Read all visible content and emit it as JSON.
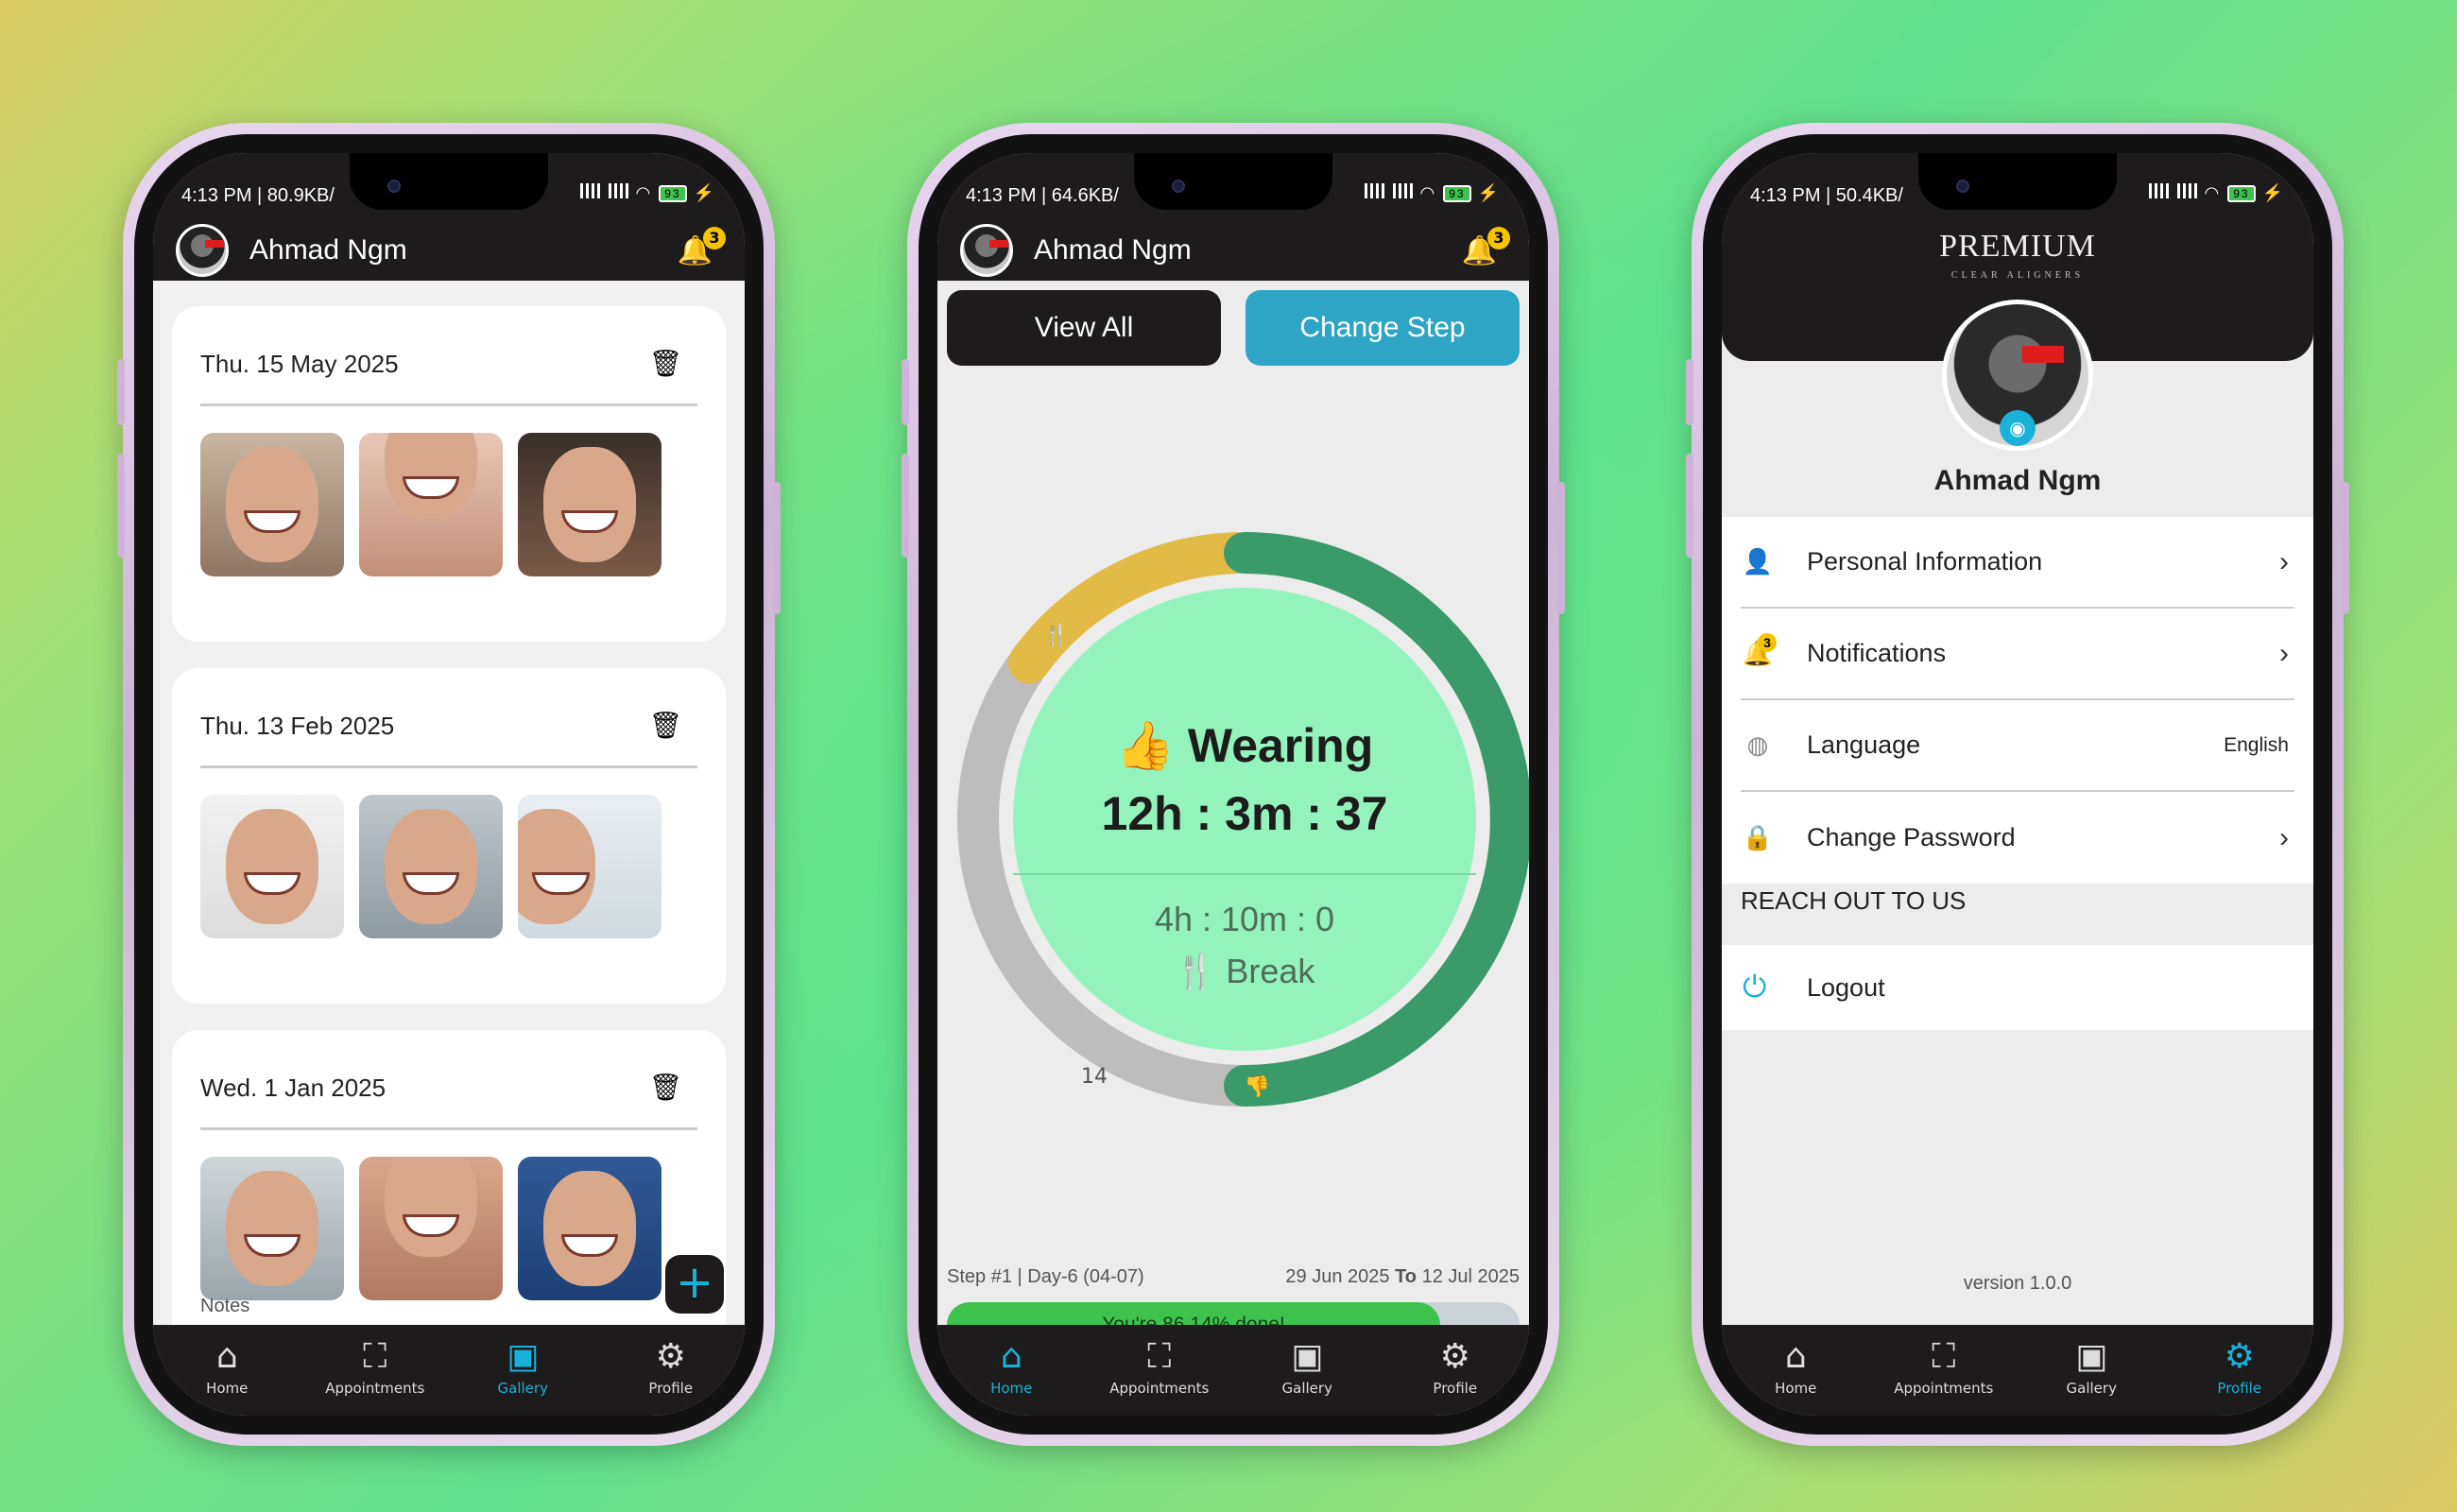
{
  "status": {
    "p1": "4:13 PM | 80.9KB/",
    "p2": "4:13 PM | 64.6KB/",
    "p3": "4:13 PM | 50.4KB/",
    "battery": "93"
  },
  "user": {
    "name": "Ahmad Ngm",
    "notification_count": "3"
  },
  "tabs": [
    {
      "label": "Home",
      "icon": "home-icon"
    },
    {
      "label": "Appointments",
      "icon": "scan-icon"
    },
    {
      "label": "Gallery",
      "icon": "image-icon"
    },
    {
      "label": "Profile",
      "icon": "gear-icon"
    }
  ],
  "gallery": {
    "entries": [
      {
        "date": "Thu. 15 May 2025"
      },
      {
        "date": "Thu. 13 Feb 2025"
      },
      {
        "date": "Wed. 1 Jan 2025"
      }
    ],
    "notes_label": "Notes",
    "add_label": "+"
  },
  "home": {
    "view_all": "View All",
    "change_step": "Change Step",
    "wearing_label": "Wearing",
    "wearing_time": "12h : 3m : 37",
    "break_time": "4h : 10m : 0",
    "break_label": "Break",
    "marker": "14",
    "step": "Step #1  |  Day-6 (04-07)",
    "date_from": "29 Jun 2025",
    "to_label": "To",
    "date_to": "12 Jul 2025",
    "progress_text": "You're 86.14% done!",
    "progress_value": 0.8614,
    "colors": {
      "wearing": "#3a9a6a",
      "break": "#e2ba46",
      "remaining": "#bdbdbd",
      "center": "#94f3bc"
    },
    "ring": {
      "wearing_fraction": 0.5,
      "break_fraction": 0.15
    }
  },
  "profile": {
    "brand": "PREMIUM",
    "brand_sub": "CLEAR ALIGNERS",
    "menu": [
      {
        "label": "Personal Information",
        "icon": "person-icon"
      },
      {
        "label": "Notifications",
        "icon": "bell-icon",
        "badge": "3"
      },
      {
        "label": "Language",
        "icon": "globe-icon",
        "value": "English"
      },
      {
        "label": "Change Password",
        "icon": "lock-icon"
      }
    ],
    "reach": "REACH OUT TO US",
    "logout": "Logout",
    "version": "version 1.0.0"
  }
}
